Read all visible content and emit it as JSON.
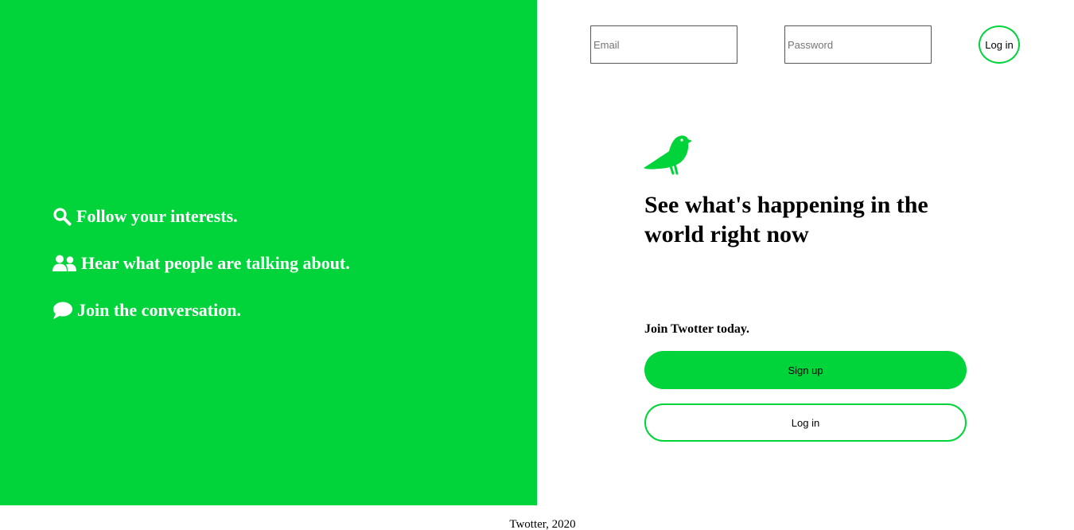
{
  "colors": {
    "brand_green": "#00d43a",
    "text_dark": "#000000",
    "text_light": "#ffffff"
  },
  "features": [
    {
      "icon": "search-icon",
      "text": "Follow your interests."
    },
    {
      "icon": "users-icon",
      "text": "Hear what people are talking about."
    },
    {
      "icon": "comment-icon",
      "text": "Join the conversation."
    }
  ],
  "login_form": {
    "email_placeholder": "Email",
    "password_placeholder": "Password",
    "login_label": "Log in"
  },
  "main": {
    "logo_icon": "bird-icon",
    "headline": "See what's happening in the world right now",
    "join_text": "Join Twotter today.",
    "signup_label": "Sign up",
    "login_label": "Log in"
  },
  "footer": {
    "text": "Twotter, 2020"
  }
}
